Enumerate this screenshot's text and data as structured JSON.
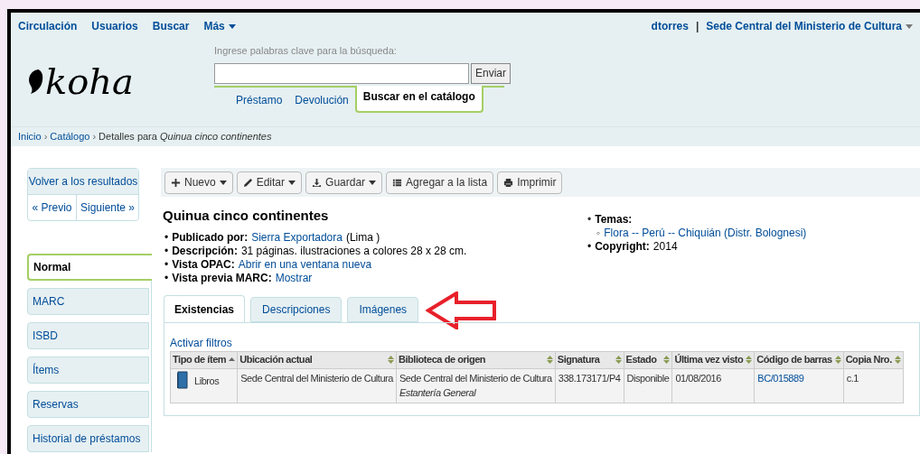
{
  "top_nav": [
    {
      "label": "Circulación",
      "dropdown": false
    },
    {
      "label": "Usuarios",
      "dropdown": false
    },
    {
      "label": "Buscar",
      "dropdown": false
    },
    {
      "label": "Más",
      "dropdown": true
    }
  ],
  "user": {
    "name": "dtorres",
    "separator": "|",
    "library": "Sede Central del Ministerio de Cultura"
  },
  "search": {
    "label": "Ingrese palabras clave para la búsqueda:",
    "button": "Enviar",
    "tabs": [
      {
        "label": "Préstamo",
        "selected": false
      },
      {
        "label": "Devolución",
        "selected": false
      },
      {
        "label": "Buscar en el catálogo",
        "selected": true
      }
    ]
  },
  "logo": "koha",
  "breadcrumb_separator": "›",
  "breadcrumb": [
    {
      "label": "Inicio",
      "kind": "link"
    },
    {
      "label": "Catálogo",
      "kind": "link"
    },
    {
      "label": "Detalles para *Quinua cinco continentes*",
      "kind": "current"
    }
  ],
  "sidebar": {
    "back": "Volver a los resultados",
    "prev": "« Previo",
    "next": "Siguiente »",
    "items": [
      {
        "label": "Normal",
        "selected": true
      },
      {
        "label": "MARC",
        "selected": false
      },
      {
        "label": "ISBD",
        "selected": false
      },
      {
        "label": "Ítems",
        "selected": false
      },
      {
        "label": "Reservas",
        "selected": false
      },
      {
        "label": "Historial de préstamos",
        "selected": false
      }
    ]
  },
  "toolbar": [
    {
      "label": "Nuevo",
      "dropdown": true
    },
    {
      "label": "Editar",
      "dropdown": true
    },
    {
      "label": "Guardar",
      "dropdown": true
    },
    {
      "label": "Agregar a la lista",
      "dropdown": false
    },
    {
      "label": "Imprimir",
      "dropdown": false
    }
  ],
  "record": {
    "title": "Quinua cinco continentes",
    "bullet": "•",
    "sub_bullet": "◦",
    "details": [
      {
        "label": "Publicado por:",
        "parts": [
          {
            "text": "Sierra Exportadora",
            "link": true
          },
          {
            "text": "(Lima )",
            "link": false
          }
        ]
      },
      {
        "label": "Descripción:",
        "parts": [
          {
            "text": "31 páginas. ilustraciones a colores 28 x 28 cm.",
            "link": false
          }
        ]
      },
      {
        "label": "Vista OPAC:",
        "parts": [
          {
            "text": "Abrir en una ventana nueva",
            "link": true
          }
        ]
      },
      {
        "label": "Vista previa MARC:",
        "parts": [
          {
            "text": "Mostrar",
            "link": true
          }
        ]
      }
    ],
    "subjects_label": "Temas:",
    "subjects": [
      "Flora -- Perú -- Chiquián (Distr. Bolognesi)"
    ],
    "copyright_label": "Copyright:",
    "copyright": "2014"
  },
  "tabs": [
    {
      "label": "Existencias",
      "selected": true
    },
    {
      "label": "Descripciones",
      "selected": false
    },
    {
      "label": "Imágenes",
      "selected": false
    }
  ],
  "holdings": {
    "filter_link": "Activar filtros",
    "columns": [
      {
        "label": "Tipo de ítem",
        "sorted": true
      },
      {
        "label": "Ubicación actual",
        "sorted": false
      },
      {
        "label": "Biblioteca de origen",
        "sorted": false
      },
      {
        "label": "Signatura",
        "sorted": false
      },
      {
        "label": "Estado",
        "sorted": false
      },
      {
        "label": "Última vez visto",
        "sorted": false
      },
      {
        "label": "Código de barras",
        "sorted": false
      },
      {
        "label": "Copia Nro.",
        "sorted": false
      }
    ],
    "rows": [
      {
        "item_type": "Libros",
        "location": "Sede Central del Ministerio de Cultura",
        "home_library": "Sede Central del Ministerio de Cultura",
        "shelf": "Estantería General",
        "call_number": "338.173171/P4",
        "status": "Disponible",
        "last_seen": "01/08/2016",
        "barcode": "BC/015889",
        "copy": "c.1"
      }
    ]
  }
}
